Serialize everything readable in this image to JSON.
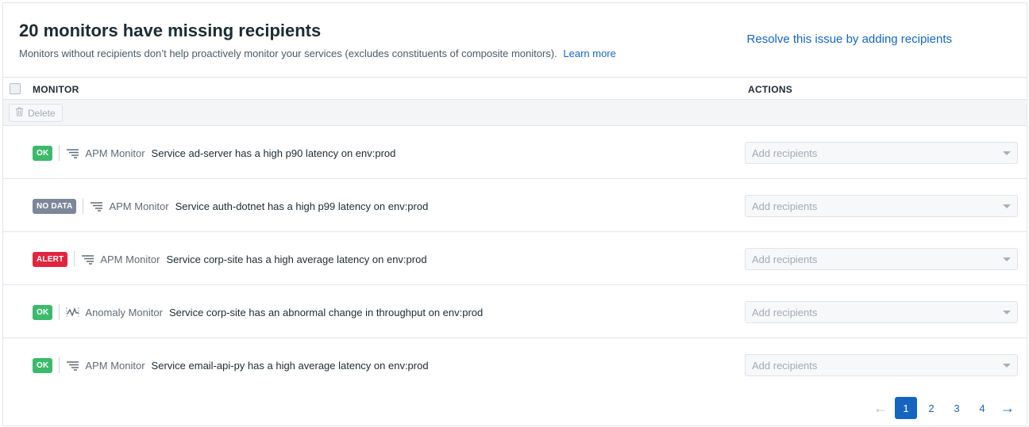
{
  "header": {
    "title": "20 monitors have missing recipients",
    "subtitle": "Monitors without recipients don’t help proactively monitor your services (excludes constituents of composite monitors).",
    "learn_more": "Learn more",
    "resolve_link": "Resolve this issue by adding recipients"
  },
  "table": {
    "col_monitor": "MONITOR",
    "col_actions": "ACTIONS",
    "delete_label": "Delete",
    "rows": [
      {
        "status": "OK",
        "status_kind": "ok",
        "type_icon": "apm-icon",
        "type_label": "APM Monitor",
        "name": "Service ad-server has a high p90 latency on env:prod",
        "recipients_placeholder": "Add recipients"
      },
      {
        "status": "NO DATA",
        "status_kind": "nodata",
        "type_icon": "apm-icon",
        "type_label": "APM Monitor",
        "name": "Service auth-dotnet has a high p99 latency on env:prod",
        "recipients_placeholder": "Add recipients"
      },
      {
        "status": "ALERT",
        "status_kind": "alert",
        "type_icon": "apm-icon",
        "type_label": "APM Monitor",
        "name": "Service corp-site has a high average latency on env:prod",
        "recipients_placeholder": "Add recipients"
      },
      {
        "status": "OK",
        "status_kind": "ok",
        "type_icon": "anomaly-icon",
        "type_label": "Anomaly Monitor",
        "name": "Service corp-site has an abnormal change in throughput on env:prod",
        "recipients_placeholder": "Add recipients"
      },
      {
        "status": "OK",
        "status_kind": "ok",
        "type_icon": "apm-icon",
        "type_label": "APM Monitor",
        "name": "Service email-api-py has a high average latency on env:prod",
        "recipients_placeholder": "Add recipients"
      }
    ]
  },
  "pagination": {
    "pages": [
      "1",
      "2",
      "3",
      "4"
    ],
    "current": "1",
    "prev_glyph": "←",
    "next_glyph": "→"
  },
  "colors": {
    "link": "#1565c0",
    "ok": "#3cba6c",
    "nodata": "#7d879a",
    "alert": "#e0253f"
  }
}
